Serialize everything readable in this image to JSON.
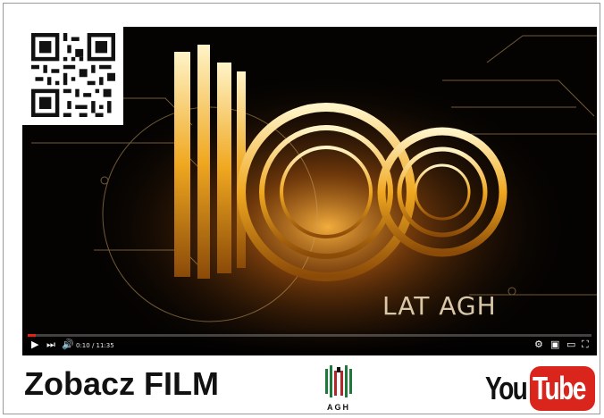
{
  "video": {
    "title_art_text": "LAT AGH",
    "time_display": "0:10 / 11:35",
    "progress": 0.014
  },
  "footer": {
    "cta_text": "Zobacz FILM",
    "agh_logo_text": "AGH",
    "youtube_you": "You",
    "youtube_tube": "Tube"
  },
  "colors": {
    "accent_red": "#e62117",
    "youtube_red": "#d9251c",
    "agh_green": "#1f7a3a",
    "agh_red": "#b3262c",
    "gold": "#f5c04a"
  },
  "icons": [
    "play-icon",
    "next-icon",
    "volume-icon",
    "settings-icon",
    "miniplayer-icon",
    "theater-icon",
    "fullscreen-icon"
  ]
}
